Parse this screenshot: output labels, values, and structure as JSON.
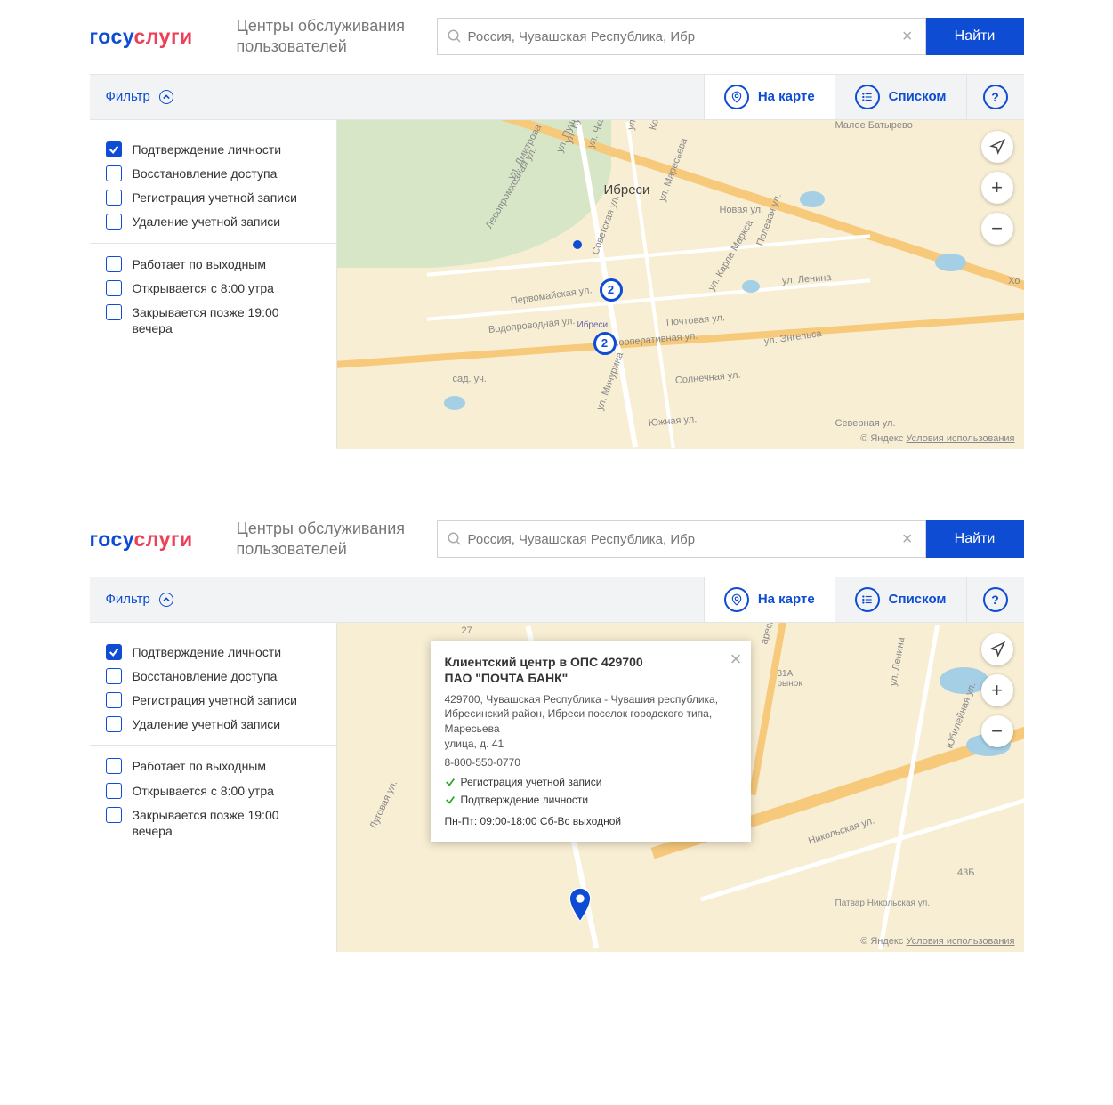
{
  "logo": {
    "p1": "госу",
    "p2": "слуги"
  },
  "title": "Центры обслуживания пользователей",
  "search": {
    "placeholder": "",
    "value": "Россия, Чувашская Республика, Ибр",
    "button": "Найти"
  },
  "toolbar": {
    "filter": "Фильтр",
    "tab_map": "На карте",
    "tab_list": "Списком",
    "help": "?"
  },
  "filters1": [
    {
      "label": "Подтверждение личности",
      "checked": true
    },
    {
      "label": "Восстановление доступа",
      "checked": false
    },
    {
      "label": "Регистрация учетной записи",
      "checked": false
    },
    {
      "label": "Удаление учетной записи",
      "checked": false
    }
  ],
  "filters2": [
    {
      "label": "Работает по выходным",
      "checked": false
    },
    {
      "label": "Открывается с 8:00 утра",
      "checked": false
    },
    {
      "label": "Закрывается позже 19:00 вечера",
      "checked": false
    }
  ],
  "map_overview": {
    "city": "Ибреси",
    "village": "Малое Батырево",
    "area": "сад. уч.",
    "extra": "Хо",
    "station": "Ибреси",
    "clusters": [
      "2",
      "2"
    ],
    "streets": [
      "ул. Куйбышева",
      "ул. Чкалова",
      "ул. Пушкина",
      "ул. Кирова",
      "Комсо",
      "ул. Дмитрова",
      "Лесопромхозная ул.",
      "ул. Маресьева",
      "Новая ул.",
      "Советская ул.",
      "Первомайская ул.",
      "Водопроводная ул.",
      "ул. Карла Маркса",
      "Кооперативная ул.",
      "Почтовая ул.",
      "ул. Энгельса",
      "ул. Ленина",
      "Полевая ул.",
      "ул. Мичурина",
      "Солнечная ул.",
      "Южная ул.",
      "31А рынок",
      "Северная ул."
    ],
    "attr_vendor": "© Яндекс",
    "attr_link": "Условия использования"
  },
  "map_detail": {
    "streets": [
      "Луговая ул.",
      "27",
      "аресьева",
      "ул. Ленина",
      "Юбилейная ул.",
      "43Б",
      "Никольская ул.",
      "Патвар Никольская ул."
    ],
    "popup": {
      "title": "Клиентский центр в ОПС 429700",
      "org": "ПАО \"ПОЧТА БАНК\"",
      "addr1": "429700, Чувашская Республика - Чувашия республика,",
      "addr2": "Ибресинский район, Ибреси поселок городского типа, Маресьева",
      "addr3": "улица, д. 41",
      "phone": "8-800-550-0770",
      "svc1": "Регистрация учетной записи",
      "svc2": "Подтверждение личности",
      "hours": "Пн-Пт: 09:00-18:00 Сб-Вс выходной"
    },
    "attr_vendor": "© Яндекс",
    "attr_link": "Условия использования"
  }
}
